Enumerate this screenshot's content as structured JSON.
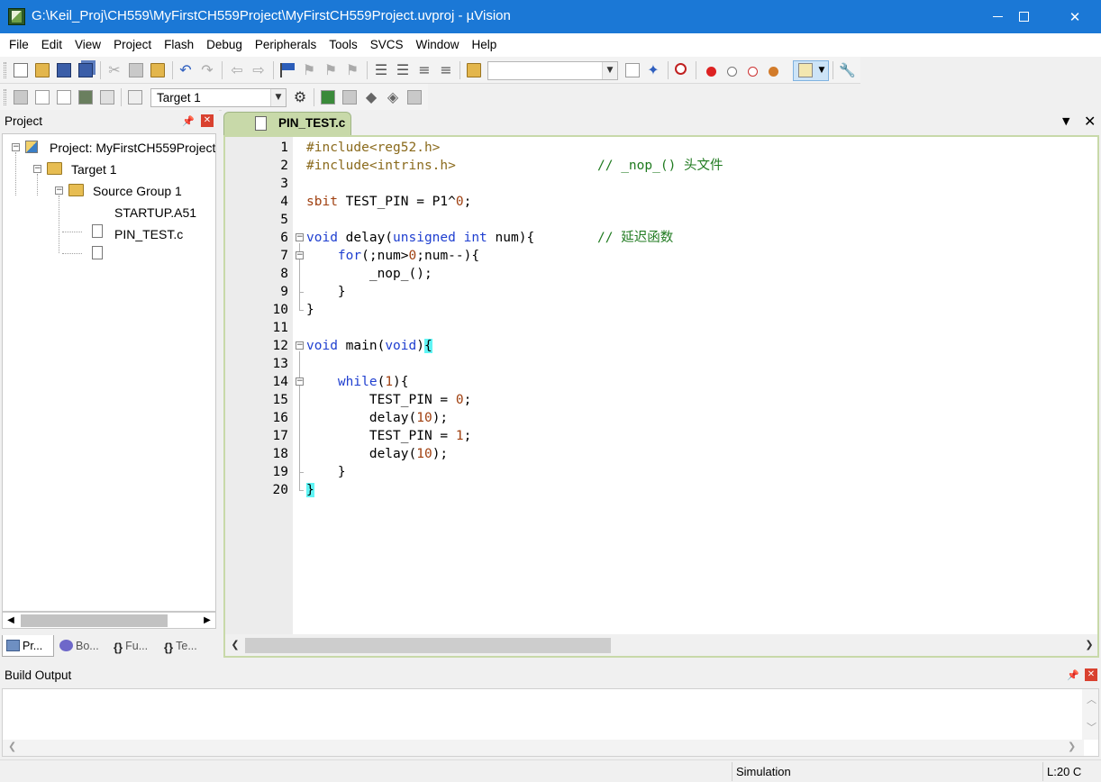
{
  "window": {
    "title": "G:\\Keil_Proj\\CH559\\MyFirstCH559Project\\MyFirstCH559Project.uvproj - µVision",
    "minimize_glyph": "",
    "close_glyph": "✕"
  },
  "menu": [
    "File",
    "Edit",
    "View",
    "Project",
    "Flash",
    "Debug",
    "Peripherals",
    "Tools",
    "SVCS",
    "Window",
    "Help"
  ],
  "toolbar": {
    "target_select": "Target 1"
  },
  "project_panel": {
    "title": "Project",
    "tree": {
      "project": "Project: MyFirstCH559Project",
      "target": "Target 1",
      "group": "Source Group 1",
      "files": [
        "STARTUP.A51",
        "PIN_TEST.c"
      ]
    },
    "tabs": [
      "Pr...",
      "Bo...",
      "Fu...",
      "Te..."
    ]
  },
  "editor": {
    "tab_label": "PIN_TEST.c",
    "line_numbers": [
      "1",
      "2",
      "3",
      "4",
      "5",
      "6",
      "7",
      "8",
      "9",
      "10",
      "11",
      "12",
      "13",
      "14",
      "15",
      "16",
      "17",
      "18",
      "19",
      "20"
    ],
    "lines": [
      [
        {
          "t": "#include<reg52.h>",
          "c": "#8a6a1c"
        }
      ],
      [
        {
          "t": "#include<intrins.h>",
          "c": "#8a6a1c"
        },
        {
          "t": "                  // _nop_() ",
          "c": "#1f7a1f"
        },
        {
          "t": "头文件",
          "c": "#1f7a1f",
          "cjk": true
        }
      ],
      [],
      [
        {
          "t": "sbit",
          "c": "#a04010"
        },
        {
          "t": " TEST_PIN = P1^",
          "c": "#000"
        },
        {
          "t": "0",
          "c": "#a04010"
        },
        {
          "t": ";",
          "c": "#000"
        }
      ],
      [],
      [
        {
          "t": "void",
          "c": "#1f3fd0"
        },
        {
          "t": " delay(",
          "c": "#000"
        },
        {
          "t": "unsigned int",
          "c": "#1f3fd0"
        },
        {
          "t": " num){        ",
          "c": "#000"
        },
        {
          "t": "// ",
          "c": "#1f7a1f"
        },
        {
          "t": "延迟函数",
          "c": "#1f7a1f",
          "cjk": true
        }
      ],
      [
        {
          "t": "    ",
          "c": "#000"
        },
        {
          "t": "for",
          "c": "#1f3fd0"
        },
        {
          "t": "(;num>",
          "c": "#000"
        },
        {
          "t": "0",
          "c": "#a04010"
        },
        {
          "t": ";num--){",
          "c": "#000"
        }
      ],
      [
        {
          "t": "        _nop_();",
          "c": "#000"
        }
      ],
      [
        {
          "t": "    }",
          "c": "#000"
        }
      ],
      [
        {
          "t": "}",
          "c": "#000"
        }
      ],
      [],
      [
        {
          "t": "void",
          "c": "#1f3fd0"
        },
        {
          "t": " main(",
          "c": "#000"
        },
        {
          "t": "void",
          "c": "#1f3fd0"
        },
        {
          "t": ")",
          "c": "#000"
        },
        {
          "t": "{",
          "c": "#000",
          "hl": true
        }
      ],
      [],
      [
        {
          "t": "    ",
          "c": "#000"
        },
        {
          "t": "while",
          "c": "#1f3fd0"
        },
        {
          "t": "(",
          "c": "#000"
        },
        {
          "t": "1",
          "c": "#a04010"
        },
        {
          "t": "){",
          "c": "#000"
        }
      ],
      [
        {
          "t": "        TEST_PIN = ",
          "c": "#000"
        },
        {
          "t": "0",
          "c": "#a04010"
        },
        {
          "t": ";",
          "c": "#000"
        }
      ],
      [
        {
          "t": "        delay(",
          "c": "#000"
        },
        {
          "t": "10",
          "c": "#a04010"
        },
        {
          "t": ");",
          "c": "#000"
        }
      ],
      [
        {
          "t": "        TEST_PIN = ",
          "c": "#000"
        },
        {
          "t": "1",
          "c": "#a04010"
        },
        {
          "t": ";",
          "c": "#000"
        }
      ],
      [
        {
          "t": "        delay(",
          "c": "#000"
        },
        {
          "t": "10",
          "c": "#a04010"
        },
        {
          "t": ");",
          "c": "#000"
        }
      ],
      [
        {
          "t": "    }",
          "c": "#000"
        }
      ],
      [
        {
          "t": "}",
          "c": "#000",
          "hl": true
        }
      ]
    ],
    "folds": [
      6,
      7,
      12,
      14
    ]
  },
  "build_output": {
    "title": "Build Output"
  },
  "statusbar": {
    "mode": "Simulation",
    "position": "L:20 C"
  },
  "colors": {
    "titlebar": "#1b78d6",
    "tab_active": "#c8d9a9",
    "brace_highlight": "#5ff5f5",
    "keyword": "#1f3fd0",
    "comment": "#1f7a1f",
    "preprocessor": "#8a6a1c",
    "number": "#a04010"
  }
}
